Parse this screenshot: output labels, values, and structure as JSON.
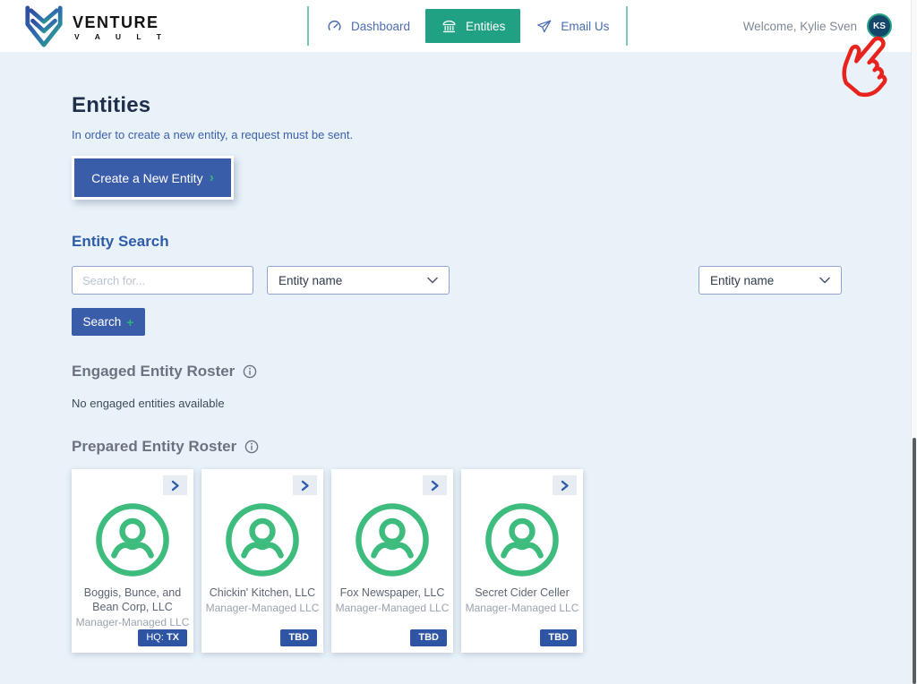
{
  "header": {
    "brand": {
      "name": "VENTURE",
      "sub": "V A U L T"
    },
    "nav": [
      {
        "label": "Dashboard"
      },
      {
        "label": "Entities"
      },
      {
        "label": "Email Us"
      }
    ],
    "welcome_text": "Welcome, Kylie Sven",
    "avatar_initials": "KS"
  },
  "main": {
    "title": "Entities",
    "subtitle": "In order to create a new entity, a request must be sent.",
    "create_button": {
      "label": "Create a New Entity",
      "chevron": "›"
    },
    "search": {
      "heading": "Entity Search",
      "input_placeholder": "Search for...",
      "input_value": "",
      "filter1_selected": "Entity name",
      "filter2_selected": "Entity name",
      "button_label": "Search",
      "button_plus": "+"
    },
    "engaged_roster": {
      "heading": "Engaged Entity Roster",
      "empty_message": "No engaged entities available"
    },
    "prepared_roster": {
      "heading": "Prepared Entity Roster",
      "cards": [
        {
          "name": "Boggis, Bunce, and Bean Corp, LLC",
          "type": "Manager-Managed LLC",
          "badge_prefix": "HQ: ",
          "badge_value": "TX"
        },
        {
          "name": "Chickin' Kitchen, LLC",
          "type": "Manager-Managed LLC",
          "badge_prefix": "",
          "badge_value": "TBD"
        },
        {
          "name": "Fox Newspaper, LLC",
          "type": "Manager-Managed LLC",
          "badge_prefix": "",
          "badge_value": "TBD"
        },
        {
          "name": "Secret Cider Celler",
          "type": "Manager-Managed LLC",
          "badge_prefix": "",
          "badge_value": "TBD"
        }
      ]
    }
  },
  "icons": {
    "gauge": "dashboard speedometer",
    "bank": "entities building",
    "paper_plane": "email send",
    "info": "info circle",
    "person_circle": "entity avatar",
    "chevron_right": "open card",
    "chevron_down": "dropdown",
    "hand_cursor": "red annotation pointer"
  },
  "colors": {
    "background": "#eaf2f9",
    "header_bg": "#ffffff",
    "accent_green": "#21a184",
    "icon_green": "#3dbc7d",
    "primary_blue": "#3a5da9",
    "badge_blue": "#2e55a4",
    "nav_blue": "#4a6db4",
    "heading_navy": "#20304c",
    "heading_gray": "#6b7380",
    "divider_teal": "#7cc8b5",
    "annotation_red": "#e8231e"
  }
}
